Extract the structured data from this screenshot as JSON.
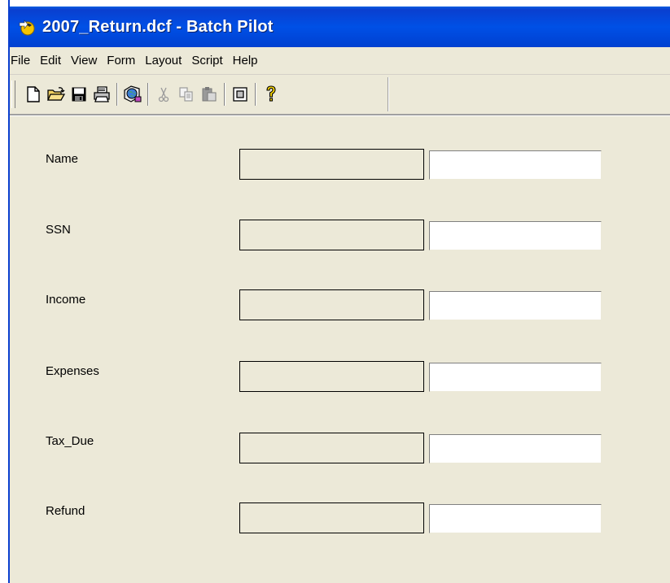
{
  "window": {
    "title": "2007_Return.dcf - Batch Pilot"
  },
  "menu": {
    "items": [
      "File",
      "Edit",
      "View",
      "Form",
      "Layout",
      "Script",
      "Help"
    ]
  },
  "toolbar": {
    "buttons": [
      {
        "icon": "new-document-icon",
        "enabled": true
      },
      {
        "icon": "open-folder-icon",
        "enabled": true
      },
      {
        "icon": "save-disk-icon",
        "enabled": true
      },
      {
        "icon": "print-icon",
        "enabled": true
      },
      {
        "icon": "globe-network-icon",
        "enabled": true
      },
      {
        "icon": "cut-icon",
        "enabled": false
      },
      {
        "icon": "copy-icon",
        "enabled": false
      },
      {
        "icon": "paste-icon",
        "enabled": false
      },
      {
        "icon": "form-frame-icon",
        "enabled": true
      },
      {
        "icon": "help-question-icon",
        "enabled": true
      }
    ]
  },
  "form": {
    "fields": [
      {
        "label": "Name",
        "value": ""
      },
      {
        "label": "SSN",
        "value": ""
      },
      {
        "label": "Income",
        "value": ""
      },
      {
        "label": "Expenses",
        "value": ""
      },
      {
        "label": "Tax_Due",
        "value": ""
      },
      {
        "label": "Refund",
        "value": ""
      }
    ]
  },
  "colors": {
    "titlebar": "#0050e6",
    "window_bg": "#ece9d8",
    "input_bg": "#ffffff"
  }
}
